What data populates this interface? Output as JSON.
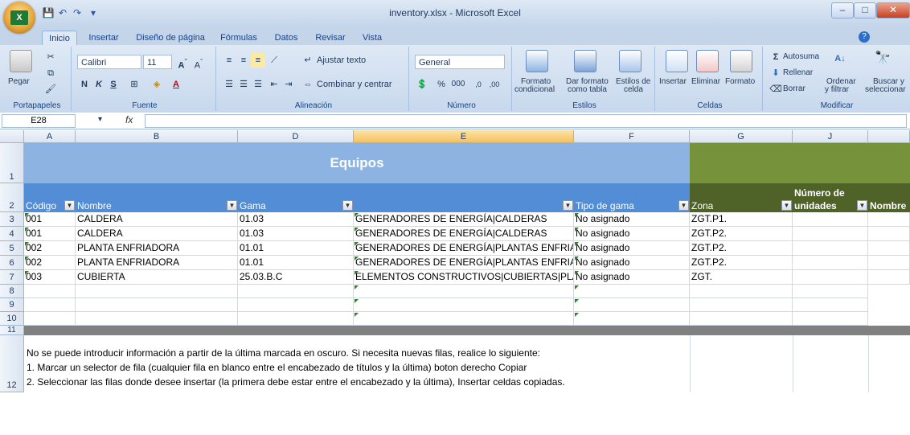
{
  "window": {
    "title": "inventory.xlsx - Microsoft Excel",
    "office_logo": "X",
    "minimize": "–",
    "maximize": "□",
    "close": "✕",
    "help": "?"
  },
  "tabs": [
    "Inicio",
    "Insertar",
    "Diseño de página",
    "Fórmulas",
    "Datos",
    "Revisar",
    "Vista"
  ],
  "ribbon": {
    "clipboard": {
      "paste": "Pegar",
      "label": "Portapapeles"
    },
    "font": {
      "name": "Calibri",
      "size": "11",
      "bold": "N",
      "italic": "K",
      "underline": "S",
      "label": "Fuente"
    },
    "alignment": {
      "wrap": "Ajustar texto",
      "merge": "Combinar y centrar",
      "label": "Alineación"
    },
    "number": {
      "format": "General",
      "percent": "%",
      "thousands": "000",
      "label": "Número"
    },
    "styles": {
      "conditional_1": "Formato",
      "conditional_2": "condicional",
      "table_1": "Dar formato",
      "table_2": "como tabla",
      "cell_1": "Estilos de",
      "cell_2": "celda",
      "label": "Estilos"
    },
    "cells": {
      "insert": "Insertar",
      "delete": "Eliminar",
      "format": "Formato",
      "label": "Celdas"
    },
    "editing": {
      "autosum": "Autosuma",
      "fill": "Rellenar",
      "clear": "Borrar",
      "sort_1": "Ordenar",
      "sort_2": "y filtrar",
      "find_1": "Buscar y",
      "find_2": "seleccionar",
      "label": "Modificar"
    }
  },
  "formula_bar": {
    "name_box": "E28",
    "fx": "fx",
    "formula": ""
  },
  "columns": [
    "A",
    "B",
    "D",
    "E",
    "F",
    "G",
    "J"
  ],
  "rows": [
    "1",
    "2",
    "3",
    "4",
    "5",
    "6",
    "7",
    "8",
    "9",
    "10",
    "11",
    "12"
  ],
  "sheet": {
    "banner": "Equipos",
    "headers": {
      "codigo": "Código",
      "nombre": "Nombre",
      "gama": "Gama",
      "tipo": "Tipo de gama",
      "zona": "Zona",
      "num_1": "Número de",
      "num_2": "unidades",
      "nombre2": "Nombre"
    },
    "data": [
      {
        "codigo": "001",
        "nombre": "CALDERA",
        "gama": "01.03",
        "desc": "GENERADORES DE ENERGÍA|CALDERAS",
        "tipo": "No asignado",
        "zona": "ZGT.P1."
      },
      {
        "codigo": "001",
        "nombre": "CALDERA",
        "gama": "01.03",
        "desc": "GENERADORES DE ENERGÍA|CALDERAS",
        "tipo": "No asignado",
        "zona": "ZGT.P2."
      },
      {
        "codigo": "002",
        "nombre": "PLANTA ENFRIADORA",
        "gama": "01.01",
        "desc": "GENERADORES DE ENERGÍA|PLANTAS ENFRIADOR",
        "tipo": "No asignado",
        "zona": "ZGT.P2."
      },
      {
        "codigo": "002",
        "nombre": "PLANTA ENFRIADORA",
        "gama": "01.01",
        "desc": "GENERADORES DE ENERGÍA|PLANTAS ENFRIADOR",
        "tipo": "No asignado",
        "zona": "ZGT.P2."
      },
      {
        "codigo": "003",
        "nombre": "CUBIERTA",
        "gama": "25.03.B.C",
        "desc": "ELEMENTOS CONSTRUCTIVOS|CUBIERTAS|PLANAS",
        "tipo": "No asignado",
        "zona": "ZGT."
      }
    ],
    "notes": [
      "No se puede introducir información a partir de la última marcada en oscuro. Si necesita nuevas filas, realice lo siguiente:",
      "1. Marcar un selector de fila (cualquier fila en blanco entre el encabezado de títulos y la última) boton derecho Copiar",
      "2. Seleccionar las filas donde desee insertar (la primera debe estar entre el encabezado y la última), Insertar celdas copiadas."
    ]
  },
  "colors": {
    "banner_blue": "#8db3e2",
    "header_blue": "#538dd5",
    "banner_green": "#76933c",
    "header_green": "#4f6228",
    "dark_row": "#808080"
  }
}
